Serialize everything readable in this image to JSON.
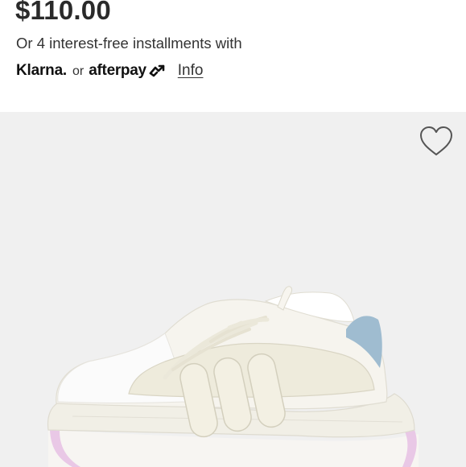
{
  "product": {
    "price": "$110.00",
    "installments_text": "Or 4 interest-free installments with",
    "pay_options": {
      "klarna": "Klarna.",
      "separator": "or",
      "afterpay": "afterpay",
      "info_link": "Info"
    }
  },
  "image": {
    "background_color": "#f0f0f0",
    "wishlist_icon": "heart-outline-icon"
  }
}
